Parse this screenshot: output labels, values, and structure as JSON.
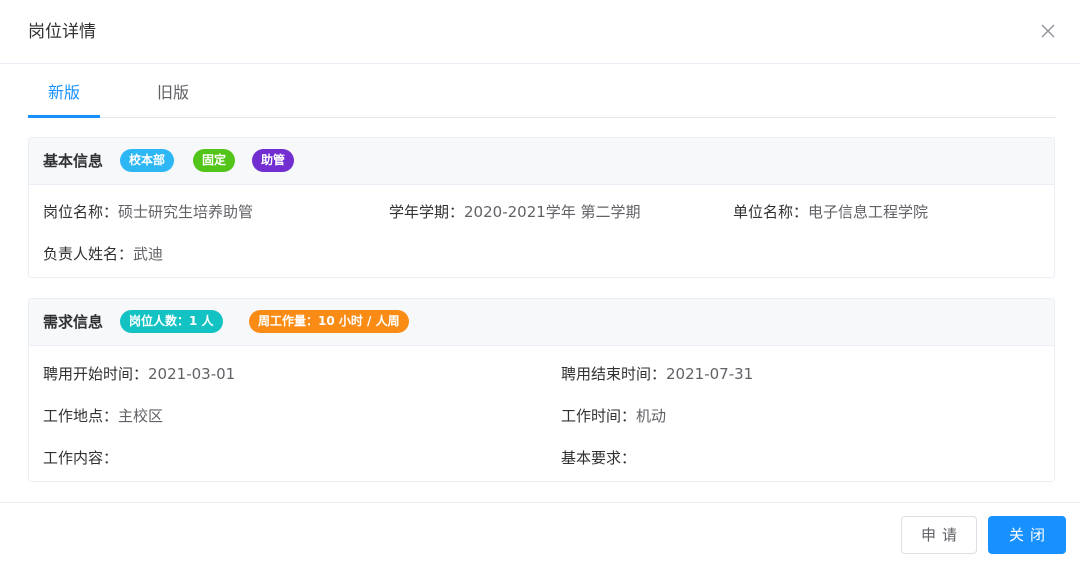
{
  "dialog": {
    "title": "岗位详情"
  },
  "tabs": [
    {
      "label": "新版",
      "active": true
    },
    {
      "label": "旧版",
      "active": false
    }
  ],
  "basic": {
    "title": "基本信息",
    "tags": [
      {
        "label": "校本部",
        "color": "#2db7f5"
      },
      {
        "label": "固定",
        "color": "#52c41a"
      },
      {
        "label": "助管",
        "color": "#722ed1"
      }
    ],
    "fields": {
      "position_name": {
        "label": "岗位名称：",
        "value": "硕士研究生培养助管"
      },
      "semester": {
        "label": "学年学期：",
        "value": "2020-2021学年 第二学期"
      },
      "unit_name": {
        "label": "单位名称：",
        "value": "电子信息工程学院"
      },
      "owner_name": {
        "label": "负责人姓名：",
        "value": "武迪"
      }
    }
  },
  "demand": {
    "title": "需求信息",
    "tags": [
      {
        "label": "岗位人数：1 人",
        "color": "#13c2c2"
      },
      {
        "label": "周工作量：10 小时 / 人周",
        "color": "#fa8c16"
      }
    ],
    "fields": {
      "start_time": {
        "label": "聘用开始时间：",
        "value": "2021-03-01"
      },
      "end_time": {
        "label": "聘用结束时间：",
        "value": "2021-07-31"
      },
      "location": {
        "label": "工作地点：",
        "value": "主校区"
      },
      "work_time": {
        "label": "工作时间：",
        "value": "机动"
      },
      "content": {
        "label": "工作内容：",
        "value": ""
      },
      "requirements": {
        "label": "基本要求：",
        "value": ""
      }
    }
  },
  "footer": {
    "apply_label": "申请",
    "close_label": "关闭"
  },
  "colors": {
    "primary": "#1890ff"
  }
}
